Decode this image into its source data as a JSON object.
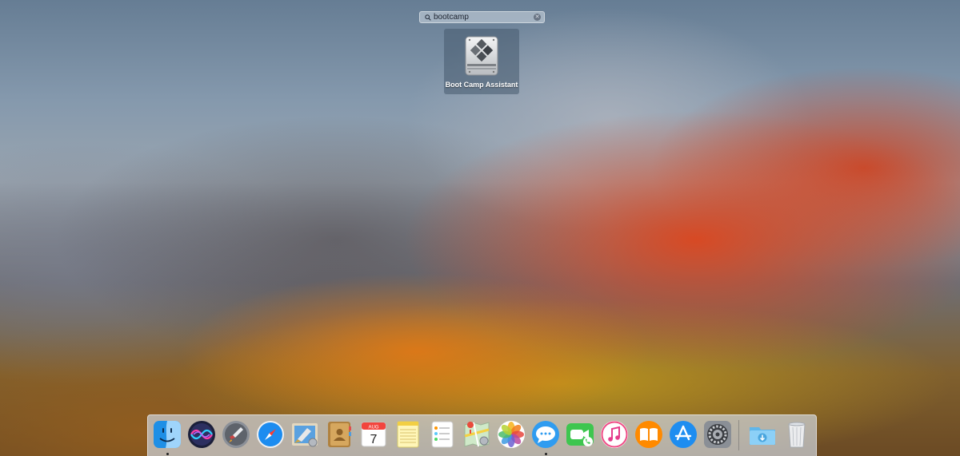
{
  "spotlight": {
    "search_value": "bootcamp",
    "clear_glyph": "✕",
    "result": {
      "label": "Boot Camp Assistant",
      "icon": "boot-camp-icon"
    }
  },
  "calendar": {
    "month": "AUG",
    "day": "7"
  },
  "dock": {
    "apps": [
      {
        "name": "Finder",
        "icon": "finder-icon",
        "running": true
      },
      {
        "name": "Siri",
        "icon": "siri-icon",
        "running": false
      },
      {
        "name": "Launchpad",
        "icon": "launchpad-icon",
        "running": false
      },
      {
        "name": "Safari",
        "icon": "safari-icon",
        "running": false
      },
      {
        "name": "Mail",
        "icon": "mail-icon",
        "running": false
      },
      {
        "name": "Contacts",
        "icon": "contacts-icon",
        "running": false
      },
      {
        "name": "Calendar",
        "icon": "calendar-icon",
        "running": false
      },
      {
        "name": "Notes",
        "icon": "notes-icon",
        "running": false
      },
      {
        "name": "Reminders",
        "icon": "reminders-icon",
        "running": false
      },
      {
        "name": "Maps",
        "icon": "maps-icon",
        "running": false
      },
      {
        "name": "Photos",
        "icon": "photos-icon",
        "running": false
      },
      {
        "name": "Messages",
        "icon": "messages-icon",
        "running": true
      },
      {
        "name": "FaceTime",
        "icon": "facetime-icon",
        "running": false
      },
      {
        "name": "iTunes",
        "icon": "itunes-icon",
        "running": false
      },
      {
        "name": "iBooks",
        "icon": "ibooks-icon",
        "running": false
      },
      {
        "name": "App Store",
        "icon": "app-store-icon",
        "running": false
      },
      {
        "name": "System Preferences",
        "icon": "system-preferences-icon",
        "running": false
      }
    ],
    "others": [
      {
        "name": "Downloads",
        "icon": "downloads-folder-icon"
      },
      {
        "name": "Trash",
        "icon": "trash-icon"
      }
    ]
  }
}
